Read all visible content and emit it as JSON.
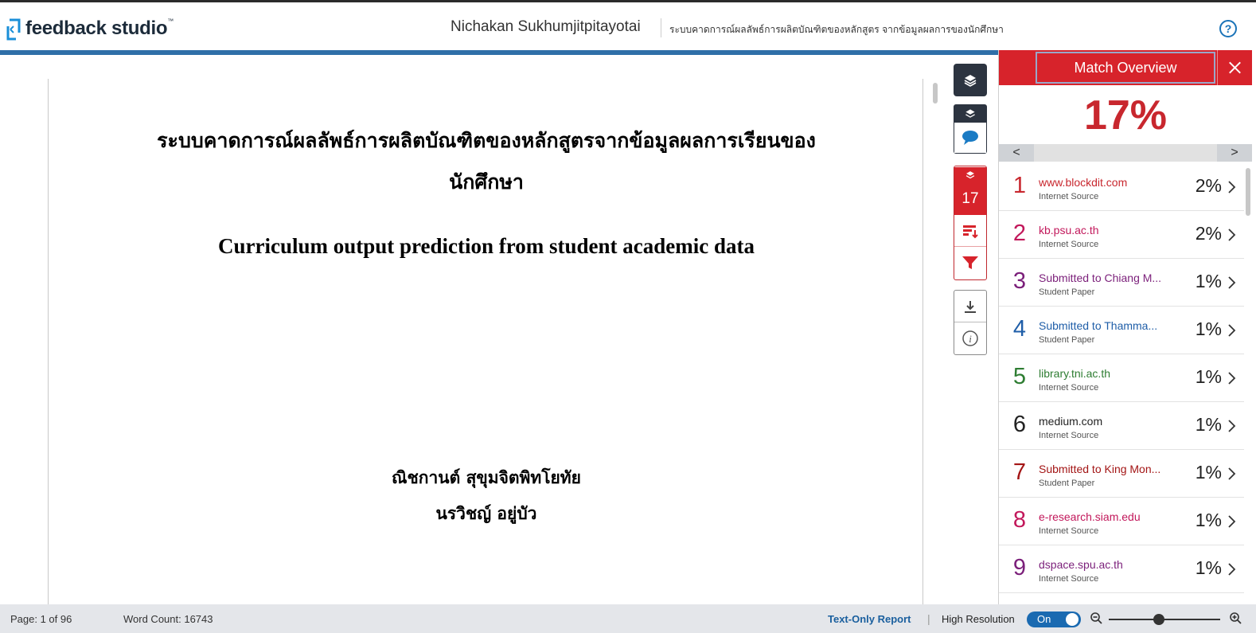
{
  "header": {
    "logo_text": "feedback studio",
    "logo_tm": "™",
    "author": "Nichakan Sukhumjitpitayotai",
    "document_title": "ระบบคาดการณ์ผลลัพธ์การผลิตบัณฑิตของหลักสูตร จากข้อมูลผลการของนักศึกษา",
    "help_label": "?"
  },
  "document": {
    "title_th_line1": "ระบบคาดการณ์ผลลัพธ์การผลิตบัณฑิตของหลักสูตรจากข้อมูลผลการเรียนของ",
    "title_th_line2": "นักศึกษา",
    "title_en": "Curriculum output prediction from student academic data",
    "author1": "ณิชกานต์ สุขุมจิตพิทโยทัย",
    "author2": "นรวิชญ์ อยู่บัว"
  },
  "toolbar": {
    "match_count": "17"
  },
  "panel": {
    "title": "Match Overview",
    "similarity": "17%",
    "prev_label": "<",
    "next_label": ">",
    "sources": [
      {
        "num": "1",
        "name": "www.blockdit.com",
        "type": "Internet Source",
        "pct": "2%",
        "color": "#c8272e"
      },
      {
        "num": "2",
        "name": "kb.psu.ac.th",
        "type": "Internet Source",
        "pct": "2%",
        "color": "#c2185b"
      },
      {
        "num": "3",
        "name": "Submitted to Chiang M...",
        "type": "Student Paper",
        "pct": "1%",
        "color": "#7b1f7a"
      },
      {
        "num": "4",
        "name": "Submitted to Thamma...",
        "type": "Student Paper",
        "pct": "1%",
        "color": "#1f5ea8"
      },
      {
        "num": "5",
        "name": "library.tni.ac.th",
        "type": "Internet Source",
        "pct": "1%",
        "color": "#2e7d32"
      },
      {
        "num": "6",
        "name": "medium.com",
        "type": "Internet Source",
        "pct": "1%",
        "color": "#222222"
      },
      {
        "num": "7",
        "name": "Submitted to King Mon...",
        "type": "Student Paper",
        "pct": "1%",
        "color": "#a31515"
      },
      {
        "num": "8",
        "name": "e-research.siam.edu",
        "type": "Internet Source",
        "pct": "1%",
        "color": "#c2185b"
      },
      {
        "num": "9",
        "name": "dspace.spu.ac.th",
        "type": "Internet Source",
        "pct": "1%",
        "color": "#7b1f7a"
      }
    ]
  },
  "status": {
    "page": "Page: 1 of 96",
    "word_count": "Word Count: 16743",
    "text_only": "Text-Only Report",
    "separator": "|",
    "high_res": "High Resolution",
    "toggle": "On"
  },
  "colors": {
    "accent_red": "#d7232b",
    "accent_blue": "#1a6ab1",
    "dark_tool": "#2c3440"
  }
}
